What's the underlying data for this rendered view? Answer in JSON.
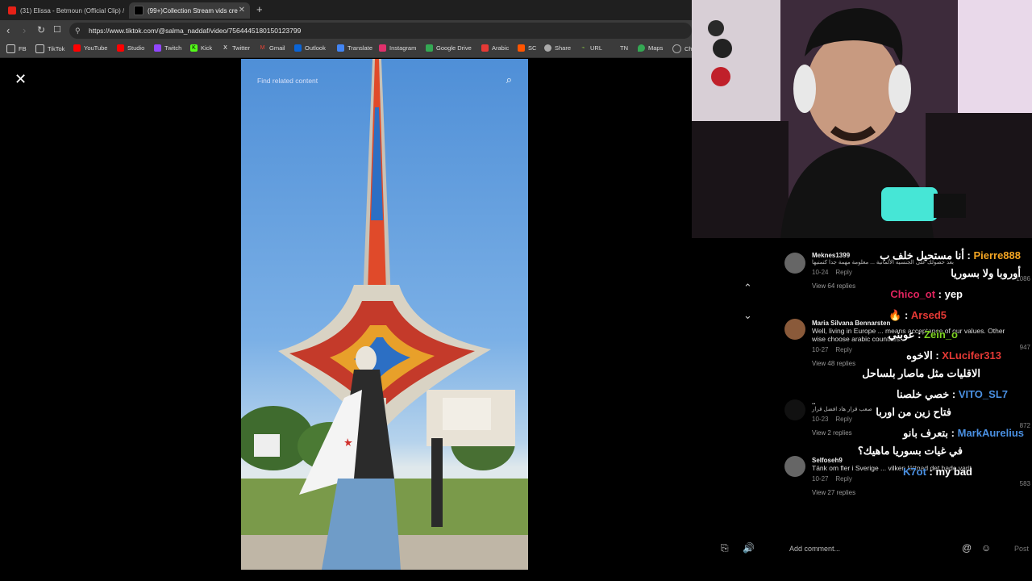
{
  "tabs": [
    {
      "title": "(31) Elissa - Betmoun (Official Clip) /",
      "color": "#e62117"
    },
    {
      "title": "(99+)Collection Stream vids cre",
      "color": "#000000"
    }
  ],
  "url": "https://www.tiktok.com/@salma_naddaf/video/7564445180150123799",
  "bookmarks": [
    {
      "label": "FB",
      "icon": "folder-icon",
      "color": "#cccccc"
    },
    {
      "label": "TikTok",
      "icon": "folder-icon",
      "color": "#cccccc"
    },
    {
      "label": "YouTube",
      "icon": "youtube-icon",
      "color": "#ff0000"
    },
    {
      "label": "Studio",
      "icon": "studio-icon",
      "color": "#ff0000"
    },
    {
      "label": "Twitch",
      "icon": "twitch-icon",
      "color": "#9146ff"
    },
    {
      "label": "Kick",
      "icon": "kick-icon",
      "color": "#53fc18"
    },
    {
      "label": "Twitter",
      "icon": "x-icon",
      "color": "#ffffff"
    },
    {
      "label": "Gmail",
      "icon": "gmail-icon",
      "color": "#ea4335"
    },
    {
      "label": "Outlook",
      "icon": "outlook-icon",
      "color": "#0a64d6"
    },
    {
      "label": "Translate",
      "icon": "translate-icon",
      "color": "#4285f4"
    },
    {
      "label": "Instagram",
      "icon": "instagram-icon",
      "color": "#e1306c"
    },
    {
      "label": "Google Drive",
      "icon": "drive-icon",
      "color": "#34a853"
    },
    {
      "label": "Arabic",
      "icon": "arabic-icon",
      "color": "#e53935"
    },
    {
      "label": "SC",
      "icon": "sc-icon",
      "color": "#ff5500"
    },
    {
      "label": "Share",
      "icon": "share-icon",
      "color": "#aaaaaa"
    },
    {
      "label": "URL",
      "icon": "url-icon",
      "color": "#7cb342"
    },
    {
      "label": "TN",
      "icon": "tn-icon",
      "color": "#aaaaaa"
    },
    {
      "label": "Maps",
      "icon": "maps-icon",
      "color": "#34a853"
    },
    {
      "label": "Ch",
      "icon": "chrome-icon",
      "color": "#aaaaaa"
    }
  ],
  "video": {
    "search_placeholder": "Find related content"
  },
  "comments": [
    {
      "user": "Meknes1399",
      "text": "بعد حصولك على الجنسية الألمانية ... معلومة مهمة جدا كتمتيها",
      "date": "10-24",
      "reply": "Reply",
      "view": "View 64 replies",
      "likes": "1086"
    },
    {
      "user": "Maria Silvana Bennarsten",
      "text": "Well, living in Europe ... means acceptance of our values. Other wise choose arabic countries.",
      "date": "10-27",
      "reply": "Reply",
      "view": "View 48 replies",
      "likes": "947"
    },
    {
      "user": "..",
      "text": "صعب قرار هاد افضل قرار",
      "date": "10-23",
      "reply": "Reply",
      "view": "View 2 replies",
      "likes": "872"
    },
    {
      "user": "Selfoseh9",
      "text": "Tänk om fler i Sverige ... vilken lättnad det hade varit",
      "date": "10-27",
      "reply": "Reply",
      "view": "View 27 replies",
      "likes": "583"
    }
  ],
  "add_comment": {
    "placeholder": "Add comment...",
    "post": "Post"
  },
  "chat": [
    {
      "user": "Pierre888",
      "color": "#f5a623",
      "msg": "أنا مستحيل خلف ب"
    },
    {
      "user": "",
      "color": "#ffffff",
      "msg": "أوروبا ولا بسوريا"
    },
    {
      "user": "Chico_ot",
      "color": "#e0245e",
      "msg": "yep"
    },
    {
      "user": "Arsed5",
      "color": "#e53935",
      "msg": ""
    },
    {
      "user": "Zein_o",
      "color": "#7ed321",
      "msg": "عوبني"
    },
    {
      "user": "XLucifer313",
      "color": "#e53935",
      "msg": "الاخوه"
    },
    {
      "user": "",
      "color": "#ffffff",
      "msg": "الاقليات مثل ماصار بلساحل"
    },
    {
      "user": "VITO_SL7",
      "color": "#4a90e2",
      "msg": "خصي خلصنا"
    },
    {
      "user": "",
      "color": "#ffffff",
      "msg": "فتاح زين من اوربا"
    },
    {
      "user": "MarkAurelius",
      "color": "#4a90e2",
      "msg": "بتعرف بانو"
    },
    {
      "user": "",
      "color": "#ffffff",
      "msg": "في غيات بسوريا ماهيك؟"
    },
    {
      "user": "K7ot",
      "color": "#4a90e2",
      "msg": "my bad"
    }
  ]
}
